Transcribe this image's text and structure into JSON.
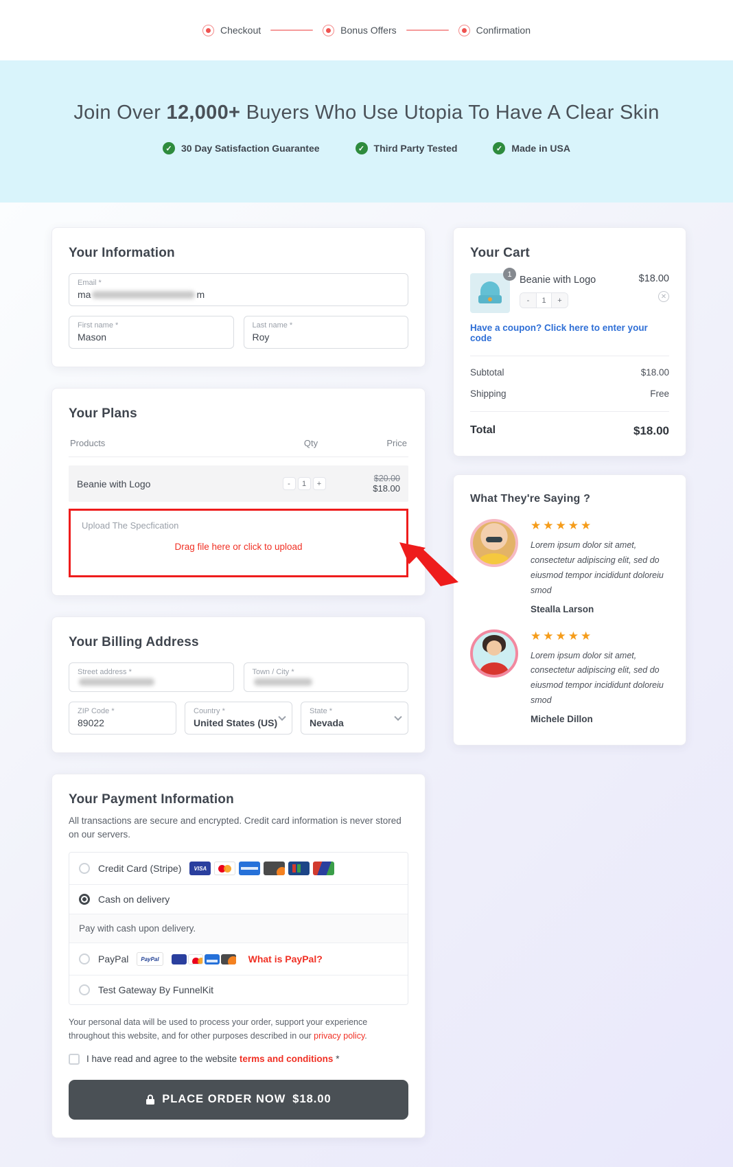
{
  "steps": [
    {
      "label": "Checkout"
    },
    {
      "label": "Bonus Offers"
    },
    {
      "label": "Confirmation"
    }
  ],
  "hero": {
    "title_pre": "Join Over ",
    "title_bold": "12,000+",
    "title_post": " Buyers Who Use Utopia To Have A Clear Skin",
    "check_glyph": "✓",
    "badges": [
      {
        "label": "30 Day Satisfaction Guarantee"
      },
      {
        "label": "Third Party Tested"
      },
      {
        "label": "Made in USA"
      }
    ]
  },
  "information": {
    "title": "Your Information",
    "email_label": "Email *",
    "email_prefix": "ma",
    "email_suffix": "m",
    "first_name_label": "First name *",
    "first_name_value": "Mason",
    "last_name_label": "Last name *",
    "last_name_value": "Roy"
  },
  "plans": {
    "title": "Your Plans",
    "columns": {
      "products": "Products",
      "qty": "Qty",
      "price": "Price"
    },
    "row": {
      "product": "Beanie with Logo",
      "qty": "1",
      "minus": "-",
      "plus": "+",
      "old_price": "$20.00",
      "price": "$18.00"
    },
    "upload_label": "Upload The Specfication",
    "upload_text": "Drag file here or click to upload"
  },
  "billing": {
    "title": "Your Billing Address",
    "street_label": "Street address *",
    "town_label": "Town / City *",
    "zip_label": "ZIP Code *",
    "zip_value": "89022",
    "country_label": "Country *",
    "country_value": "United States (US)",
    "state_label": "State *",
    "state_value": "Nevada"
  },
  "payment": {
    "title": "Your Payment Information",
    "subtitle": "All transactions are secure and encrypted. Credit card information is never stored on our servers.",
    "methods": [
      {
        "label": "Credit Card (Stripe)"
      },
      {
        "label": "Cash on delivery",
        "description": "Pay with cash upon delivery."
      },
      {
        "label": "PayPal",
        "badge": "PayPal",
        "link": "What is PayPal?"
      },
      {
        "label": "Test Gateway By FunnelKit"
      }
    ],
    "card_brands": [
      "VISA",
      "Mastercard",
      "American Express",
      "Discover",
      "JCB",
      "Diners Club"
    ],
    "privacy_pre": "Your personal data will be used to process your order, support your experience throughout this website, and for other purposes described in our ",
    "privacy_link": "privacy policy",
    "privacy_suffix": ".",
    "terms_pre": "I have read and agree to the website ",
    "terms_link": "terms and conditions",
    "terms_suffix": " *",
    "order_button_label": "PLACE ORDER NOW",
    "order_button_price": "$18.00"
  },
  "cart": {
    "title": "Your Cart",
    "item": {
      "name": "Beanie with Logo",
      "badge": "1",
      "qty": "1",
      "minus": "-",
      "plus": "+",
      "price": "$18.00",
      "remove_glyph": "✕"
    },
    "coupon_link": "Have a coupon? Click here to enter your code",
    "subtotal_label": "Subtotal",
    "subtotal_value": "$18.00",
    "shipping_label": "Shipping",
    "shipping_value": "Free",
    "total_label": "Total",
    "total_value": "$18.00"
  },
  "testimonials": {
    "title": "What They're Saying ?",
    "items": [
      {
        "stars": "★★★★★",
        "text": "Lorem ipsum dolor sit amet, consectetur adipiscing elit, sed do eiusmod tempor incididunt doloreiu smod",
        "name": "Stealla Larson"
      },
      {
        "stars": "★★★★★",
        "text": "Lorem ipsum dolor sit amet, consectetur adipiscing elit, sed do eiusmod tempor incididunt doloreiu smod",
        "name": "Michele Dillon"
      }
    ]
  },
  "colors": {
    "hero_bg": "#d9f4fb",
    "annotation_red": "#ee1c1c",
    "upload_text_red": "#f03024",
    "link_blue": "#2f6fd6",
    "step_pink": "#f48a8a",
    "badge_green": "#2e8b3d",
    "button_dark": "#4a5055",
    "stars_orange": "#f59c1a"
  }
}
